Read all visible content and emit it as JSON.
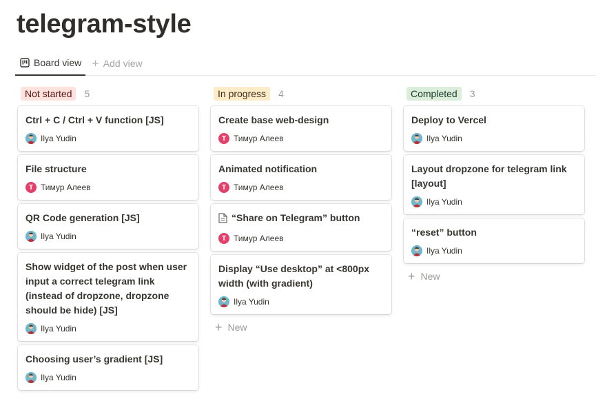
{
  "page": {
    "title": "telegram-style"
  },
  "tabs": {
    "board_view": "Board view",
    "add_view": "Add view"
  },
  "columns": [
    {
      "label": "Not started",
      "count": "5",
      "tag_bg": "#ffe2dd",
      "tag_color": "#5d1715",
      "cards": [
        {
          "title": "Ctrl + C / Ctrl + V function [JS]",
          "person": "Ilya Yudin",
          "avatar": "photo"
        },
        {
          "title": "File structure",
          "person": "Тимур Алеев",
          "avatar": "T"
        },
        {
          "title": "QR Code generation [JS]",
          "person": "Ilya Yudin",
          "avatar": "photo"
        },
        {
          "title": "Show widget of the post when user input a correct telegram link (instead of dropzone, dropzone should be hide) [JS]",
          "person": "Ilya Yudin",
          "avatar": "photo"
        },
        {
          "title": "Choosing user’s gradient [JS]",
          "person": "Ilya Yudin",
          "avatar": "photo"
        }
      ]
    },
    {
      "label": "In progress",
      "count": "4",
      "tag_bg": "#fdecc8",
      "tag_color": "#402c1b",
      "new_label": "New",
      "cards": [
        {
          "title": "Create base web-design",
          "person": "Тимур Алеев",
          "avatar": "T"
        },
        {
          "title": "Animated notification",
          "person": "Тимур Алеев",
          "avatar": "T"
        },
        {
          "title": "“Share on Telegram” button",
          "person": "Тимур Алеев",
          "avatar": "T",
          "doc_icon": true
        },
        {
          "title": "Display “Use desktop” at <800px width (with gradient)",
          "person": "Ilya Yudin",
          "avatar": "photo"
        }
      ]
    },
    {
      "label": "Completed",
      "count": "3",
      "tag_bg": "#dbeddb",
      "tag_color": "#1c3829",
      "new_label": "New",
      "cards": [
        {
          "title": "Deploy to Vercel",
          "person": "Ilya Yudin",
          "avatar": "photo"
        },
        {
          "title": "Layout dropzone for telegram link [layout]",
          "person": "Ilya Yudin",
          "avatar": "photo"
        },
        {
          "title": "“reset” button",
          "person": "Ilya Yudin",
          "avatar": "photo"
        }
      ]
    }
  ]
}
